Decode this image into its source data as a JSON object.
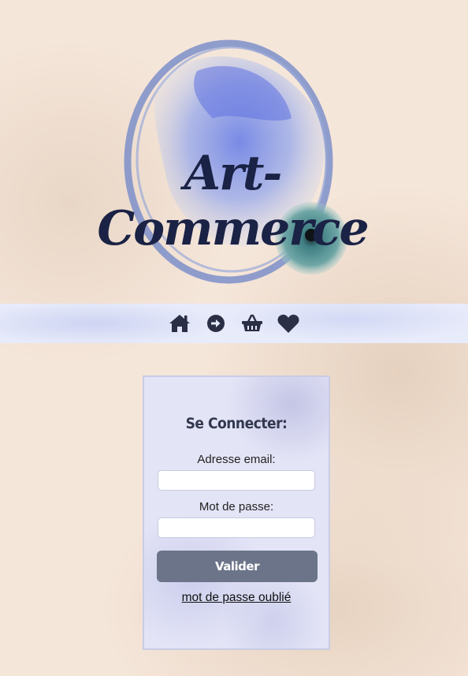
{
  "logo": {
    "text": "Art-Commerce"
  },
  "nav": {
    "items": [
      {
        "icon": "home-icon",
        "label": "Accueil"
      },
      {
        "icon": "arrow-right-circle-icon",
        "label": "Connexion"
      },
      {
        "icon": "basket-icon",
        "label": "Panier"
      },
      {
        "icon": "heart-icon",
        "label": "Favoris"
      }
    ]
  },
  "login": {
    "title": "Se Connecter:",
    "email_label": "Adresse email:",
    "email_value": "",
    "password_label": "Mot de passe:",
    "password_value": "",
    "submit_label": "Valider",
    "forgot_label": "mot de passe oublié"
  },
  "colors": {
    "page_bg": "#f5e6da",
    "nav_bg": "#e8ebfa",
    "card_bg": "#e3e4f6",
    "button_bg": "#6c7489",
    "logo_text": "#1a2245",
    "icon": "#2a2f45"
  }
}
